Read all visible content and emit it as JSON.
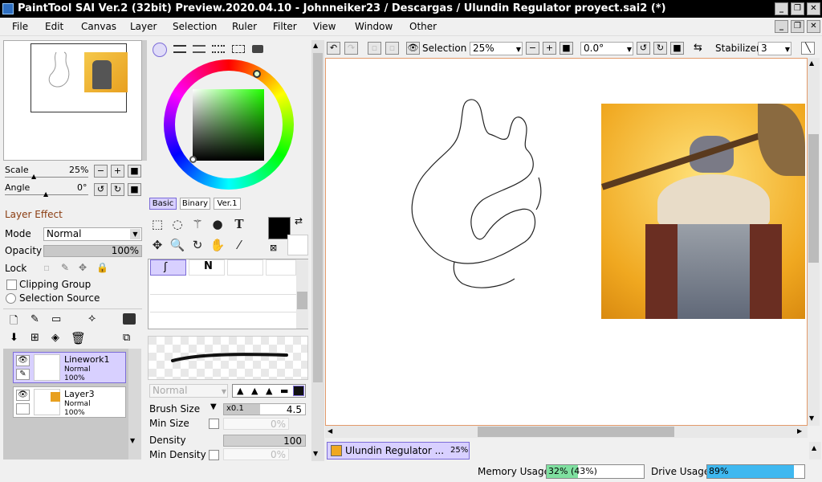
{
  "window": {
    "title": "PaintTool SAI Ver.2 (32bit) Preview.2020.04.10 - Johnneiker23 / Descargas / Ulundin Regulator proyect.sai2 (*)"
  },
  "menu": [
    "File",
    "Edit",
    "Canvas",
    "Layer",
    "Selection",
    "Ruler",
    "Filter",
    "View",
    "Window",
    "Other"
  ],
  "navigator": {
    "scale_label": "Scale",
    "scale_value": "25%",
    "angle_label": "Angle",
    "angle_value": "0°"
  },
  "layer_effect": {
    "header": "Layer Effect",
    "mode_label": "Mode",
    "mode_value": "Normal",
    "opacity_label": "Opacity",
    "opacity_value": "100%",
    "lock_label": "Lock",
    "clipping_label": "Clipping Group",
    "selection_source_label": "Selection Source"
  },
  "layers": [
    {
      "name": "Linework1",
      "mode": "Normal",
      "opacity": "100%",
      "selected": true
    },
    {
      "name": "Layer3",
      "mode": "Normal",
      "opacity": "100%",
      "selected": false
    }
  ],
  "color_tabs": [
    "Basic",
    "Binary",
    "Ver.1"
  ],
  "brush": {
    "blend_mode": "Normal",
    "size_label": "Brush Size",
    "size_mult": "x0.1",
    "size_value": "4.5",
    "min_size_label": "Min Size",
    "min_size_value": "0%",
    "density_label": "Density",
    "density_value": "100",
    "min_density_label": "Min Density",
    "min_density_value": "0%"
  },
  "toolbar": {
    "selection_label": "Selection",
    "zoom_value": "25%",
    "angle_value": "0.0°",
    "stabilizer_label": "Stabilizer",
    "stabilizer_value": "3"
  },
  "doc_tab": {
    "name": "Ulundin Regulator ...",
    "zoom": "25%"
  },
  "status": {
    "memory_label": "Memory Usage",
    "memory_value": "32% (43%)",
    "memory_fill": 0.32,
    "drive_label": "Drive Usage",
    "drive_value": "89%",
    "drive_fill": 0.89
  },
  "colors": {
    "accent": "#8a3c10",
    "selected_layer": "#d8d0ff",
    "canvas_border": "#e39a6a",
    "memory_fill": "#7fe0a0",
    "drive_fill": "#3fb8f0"
  }
}
